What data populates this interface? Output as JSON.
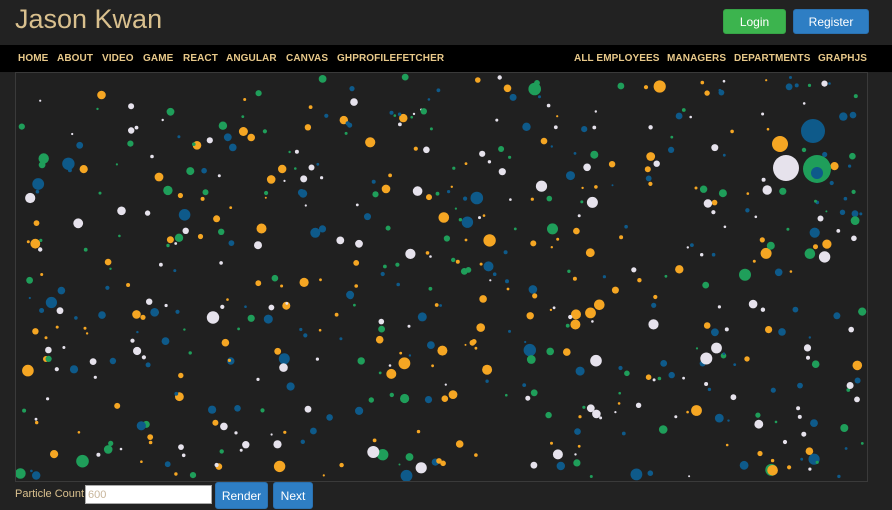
{
  "header": {
    "brand": "Jason Kwan",
    "login_label": "Login",
    "register_label": "Register"
  },
  "nav": {
    "left_items": [
      {
        "label": "HOME",
        "name": "nav-home"
      },
      {
        "label": "ABOUT",
        "name": "nav-about"
      },
      {
        "label": "VIDEO",
        "name": "nav-video"
      },
      {
        "label": "GAME",
        "name": "nav-game"
      },
      {
        "label": "REACT",
        "name": "nav-react"
      },
      {
        "label": "ANGULAR",
        "name": "nav-angular"
      },
      {
        "label": "CANVAS",
        "name": "nav-canvas"
      },
      {
        "label": "GHPROFILEFETCHER",
        "name": "nav-ghprofilefetcher"
      }
    ],
    "right_items": [
      {
        "label": "ALL EMPLOYEES",
        "name": "nav-all-employees"
      },
      {
        "label": "MANAGERS",
        "name": "nav-managers"
      },
      {
        "label": "DEPARTMENTS",
        "name": "nav-departments"
      },
      {
        "label": "GRAPHJS",
        "name": "nav-graphjs"
      }
    ]
  },
  "controls": {
    "particle_count_label": "Particle Count:",
    "particle_count_placeholder": "600",
    "render_label": "Render",
    "next_label": "Next"
  },
  "particles": {
    "count": 600,
    "colors": [
      "#f5a623",
      "#1f9e5a",
      "#0e5a8a",
      "#e6e2ec"
    ],
    "background": "#202020"
  }
}
